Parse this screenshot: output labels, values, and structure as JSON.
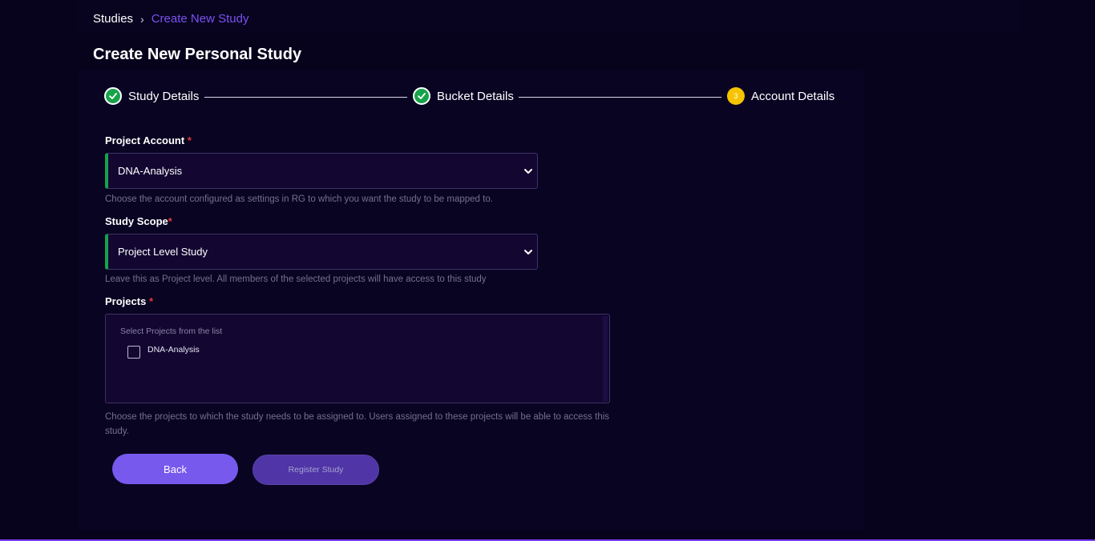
{
  "breadcrumb": {
    "root": "Studies",
    "current": "Create New Study"
  },
  "page_title": "Create New Personal Study",
  "stepper": {
    "steps": [
      {
        "label": "Study Details",
        "state": "done"
      },
      {
        "label": "Bucket Details",
        "state": "done"
      },
      {
        "label": "Account Details",
        "state": "active",
        "number": "3"
      }
    ]
  },
  "project_account": {
    "label": "Project Account",
    "required_mark": "*",
    "value": "DNA-Analysis",
    "help": "Choose the account configured as settings in RG to which you want the study to be mapped to."
  },
  "study_scope": {
    "label": "Study Scope",
    "required_mark": "*",
    "value": "Project Level Study",
    "help": "Leave this as Project level. All members of the selected projects will have access to this study"
  },
  "projects": {
    "label": "Projects",
    "required_mark": "*",
    "hint": "Select Projects from the list",
    "items": [
      {
        "label": "DNA-Analysis",
        "checked": false
      }
    ],
    "help": "Choose the projects to which the study needs to be assigned to. Users assigned to these projects will be able to access this study."
  },
  "actions": {
    "back_label": "Back",
    "register_label": "Register Study"
  },
  "colors": {
    "accent": "#7759ee",
    "success": "#16a34a",
    "active_step": "#f5c400",
    "required": "#e03a3a"
  },
  "icons": {
    "step_done": "check-icon",
    "select": "chevron-down-icon",
    "breadcrumb_separator": "chevron-right-icon"
  }
}
